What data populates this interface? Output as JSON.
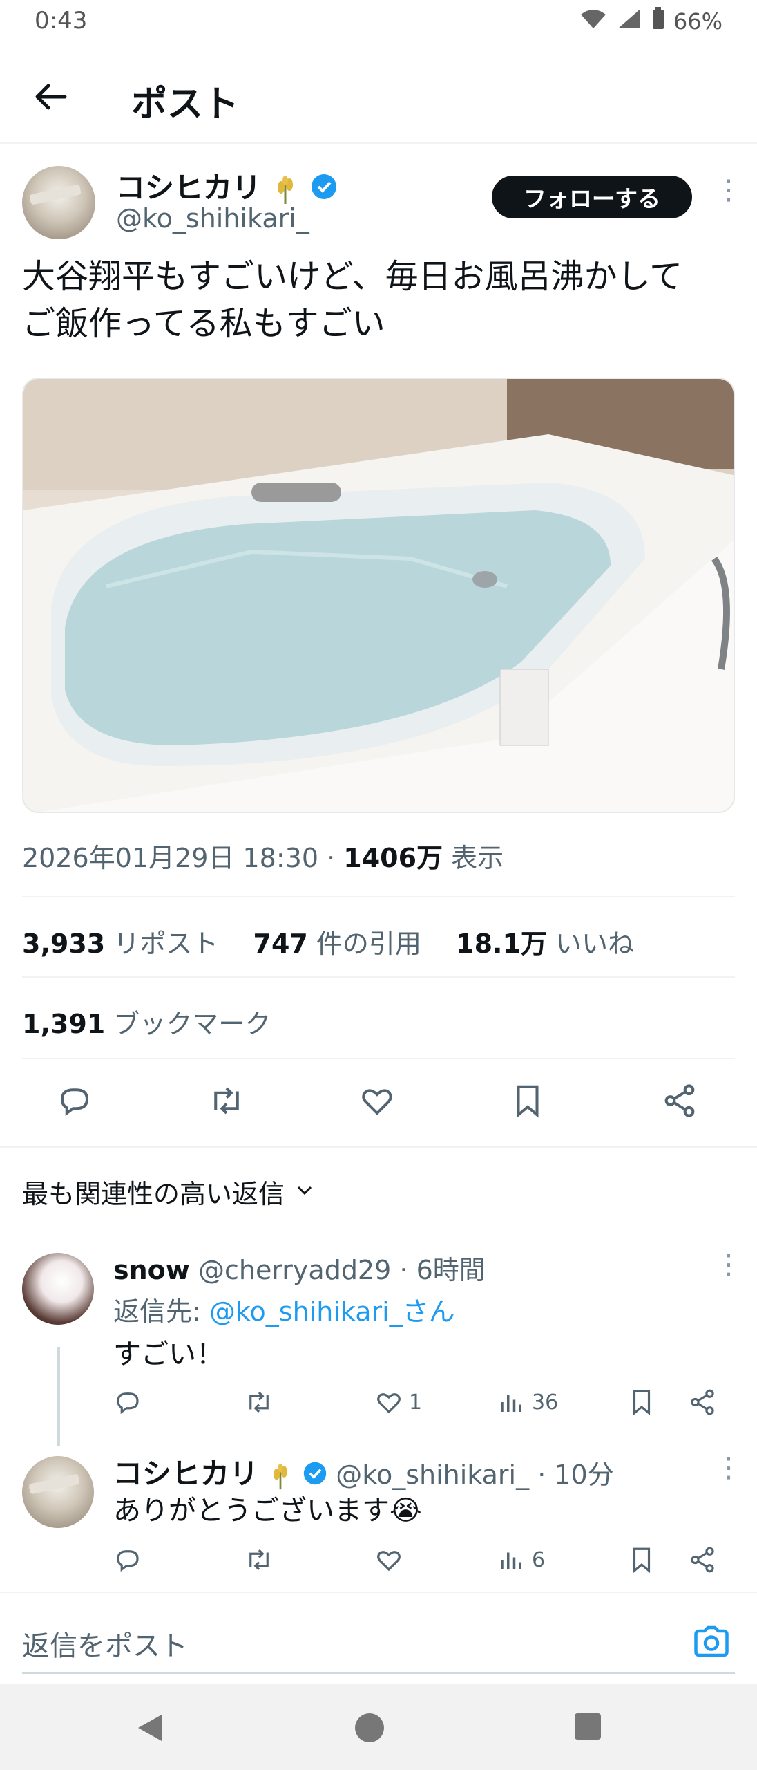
{
  "status_bar": {
    "time": "0:43",
    "battery": "66%"
  },
  "header": {
    "title": "ポスト"
  },
  "post": {
    "author_name": "コシヒカリ",
    "author_handle": "@ko_shihikari_",
    "follow_label": "フォローする",
    "text_line1": "大谷翔平もすごいけど、毎日お風呂沸かして",
    "text_line2": "ご飯作ってる私もすごい",
    "timestamp": "2026年01月29日 18:30",
    "view_count": "1406万",
    "view_label": "表示",
    "reposts_count": "3,933",
    "reposts_label": "リポスト",
    "quotes_count": "747",
    "quotes_label": "件の引用",
    "likes_count": "18.1万",
    "likes_label": "いいね",
    "bookmarks_count": "1,391",
    "bookmarks_label": "ブックマーク"
  },
  "replies_section": {
    "sort_label": "最も関連性の高い返信"
  },
  "replies": [
    {
      "name": "snow",
      "handle": "@cherryadd29",
      "time": "6時間",
      "reply_to_prefix": "返信先: ",
      "reply_to_handle": "@ko_shihikari_さん",
      "text": "すごい！",
      "likes": "1",
      "views": "36"
    },
    {
      "name": "コシヒカリ",
      "handle": "@ko_shihikari_",
      "time": "10分",
      "text": "ありがとうございます😭",
      "views": "6"
    }
  ],
  "composer": {
    "placeholder": "返信をポスト"
  },
  "colors": {
    "accent": "#1d9bf0",
    "text": "#0f1419",
    "muted": "#536471"
  }
}
